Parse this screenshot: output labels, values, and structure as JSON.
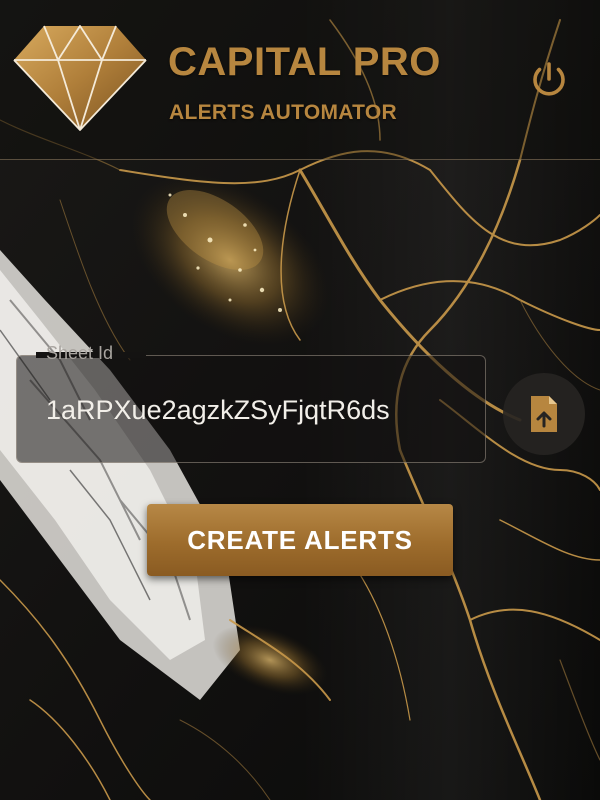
{
  "header": {
    "title": "CAPITAL PRO",
    "subtitle": "ALERTS AUTOMATOR"
  },
  "sheet": {
    "label": "Sheet Id",
    "value": "1aRPXue2agzkZSyFjqtR6ds"
  },
  "actions": {
    "create_label": "CREATE ALERTS"
  },
  "icons": {
    "logo": "diamond-icon",
    "power": "power-icon",
    "upload": "file-upload-icon"
  },
  "colors": {
    "gold": "#b7863f",
    "button_gold": "#a5763a",
    "background": "#0c0b0a"
  }
}
